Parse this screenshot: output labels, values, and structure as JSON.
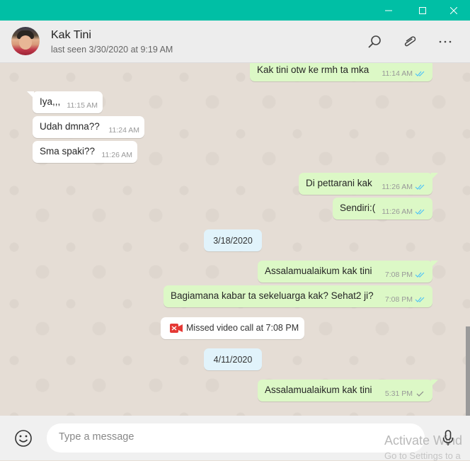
{
  "contact": {
    "name": "Kak Tini",
    "last_seen": "last seen 3/30/2020 at 9:19 AM"
  },
  "messages": [
    {
      "direction": "out",
      "text": "Kak tini otw ke rmh ta mka",
      "time": "11:14 AM",
      "status": "read"
    },
    {
      "direction": "in",
      "text": "Iya,,,",
      "time": "11:15 AM"
    },
    {
      "direction": "in",
      "text": "Udah dmna??",
      "time": "11:24 AM"
    },
    {
      "direction": "in",
      "text": "Sma spaki??",
      "time": "11:26 AM"
    },
    {
      "direction": "out",
      "text": "Di pettarani kak",
      "time": "11:26 AM",
      "status": "read"
    },
    {
      "direction": "out",
      "text": "Sendiri:(",
      "time": "11:26 AM",
      "status": "read"
    },
    {
      "direction": "out",
      "text": "Assalamualaikum kak tini",
      "time": "7:08 PM",
      "status": "read"
    },
    {
      "direction": "out",
      "text": "Bagiamana kabar ta sekeluarga kak? Sehat2 ji?",
      "time": "7:08 PM",
      "status": "read"
    },
    {
      "direction": "out",
      "text": "Assalamualaikum kak tini",
      "time": "5:31 PM",
      "status": "sent"
    }
  ],
  "date_separators": [
    "3/18/2020",
    "4/11/2020"
  ],
  "missed_call": "Missed video call at 7:08 PM",
  "composer": {
    "placeholder": "Type a message"
  },
  "watermark": {
    "line1": "Activate Wind",
    "line2": "Go to Settings to a"
  },
  "colors": {
    "titlebar": "#00bfa5",
    "outgoing_bubble": "#dcf8c6",
    "incoming_bubble": "#ffffff",
    "read_tick": "#4fc3f7",
    "missed_call_icon": "#e53935"
  },
  "icons": {
    "header": [
      "search-icon",
      "attach-icon",
      "more-icon"
    ],
    "window": [
      "minimize-icon",
      "maximize-icon",
      "close-icon"
    ],
    "composer": [
      "emoji-icon",
      "mic-icon"
    ]
  }
}
